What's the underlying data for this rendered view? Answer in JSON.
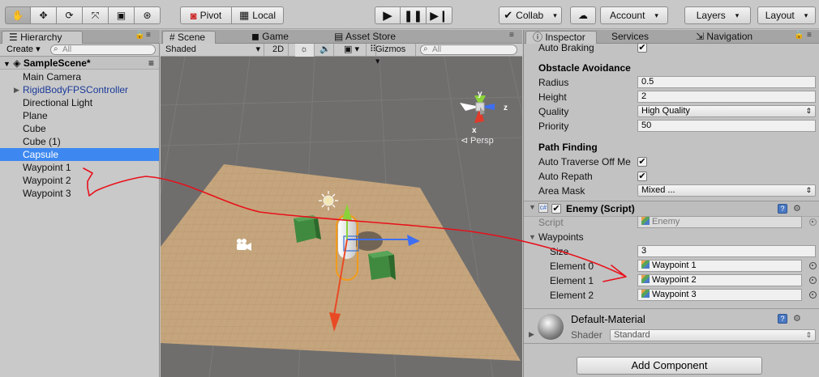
{
  "toolbar": {
    "pivot_label": "Pivot",
    "local_label": "Local",
    "collab_label": "Collab",
    "account_label": "Account",
    "layers_label": "Layers",
    "layout_label": "Layout"
  },
  "hierarchy": {
    "tab": "Hierarchy",
    "create_label": "Create",
    "search_placeholder": "All",
    "scene_name": "SampleScene*",
    "items": [
      {
        "label": "Main Camera"
      },
      {
        "label": "RigidBodyFPSController"
      },
      {
        "label": "Directional Light"
      },
      {
        "label": "Plane"
      },
      {
        "label": "Cube"
      },
      {
        "label": "Cube (1)"
      },
      {
        "label": "Capsule"
      },
      {
        "label": "Waypoint 1"
      },
      {
        "label": "Waypoint 2"
      },
      {
        "label": "Waypoint 3"
      }
    ]
  },
  "scene": {
    "tabs": [
      "Scene",
      "Game",
      "Asset Store"
    ],
    "shading": "Shaded",
    "mode_2d": "2D",
    "gizmos_label": "Gizmos",
    "search_placeholder": "All",
    "gizmo_y": "y",
    "gizmo_z": "z",
    "gizmo_x": "x",
    "persp_label": "Persp"
  },
  "inspector": {
    "tabs": [
      "Inspector",
      "Services",
      "Navigation"
    ],
    "auto_braking": "Auto Braking",
    "obstacle_title": "Obstacle Avoidance",
    "radius_label": "Radius",
    "radius_value": "0.5",
    "height_label": "Height",
    "height_value": "2",
    "quality_label": "Quality",
    "quality_value": "High Quality",
    "priority_label": "Priority",
    "priority_value": "50",
    "pathfinding_title": "Path Finding",
    "auto_traverse_label": "Auto Traverse Off Me",
    "auto_repath_label": "Auto Repath",
    "area_mask_label": "Area Mask",
    "area_mask_value": "Mixed ...",
    "script_component": "Enemy (Script)",
    "script_label": "Script",
    "script_value": "Enemy",
    "waypoints_label": "Waypoints",
    "size_label": "Size",
    "size_value": "3",
    "elements": [
      {
        "label": "Element 0",
        "value": "Waypoint 1"
      },
      {
        "label": "Element 1",
        "value": "Waypoint 2"
      },
      {
        "label": "Element 2",
        "value": "Waypoint 3"
      }
    ],
    "material_name": "Default-Material",
    "shader_label": "Shader",
    "shader_value": "Standard",
    "add_component": "Add Component"
  },
  "colors": {
    "selection": "#3d88f0",
    "annotation": "#e8101a"
  }
}
